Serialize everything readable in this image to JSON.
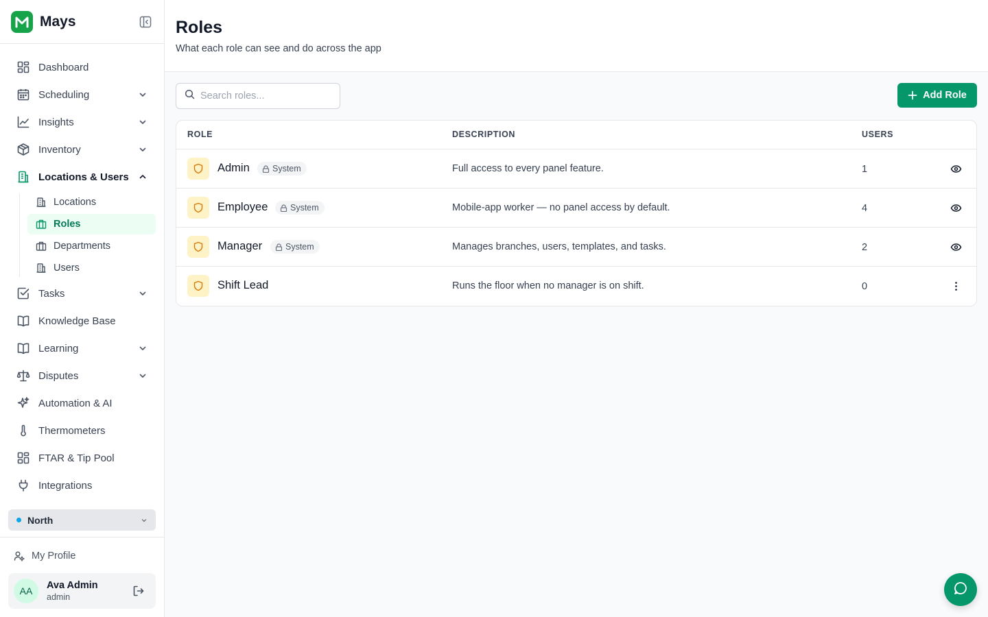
{
  "brand": {
    "name": "Mays",
    "accent": "#16a34a"
  },
  "sidebar": {
    "items": [
      {
        "label": "Dashboard",
        "icon": "dashboard-icon",
        "expandable": false
      },
      {
        "label": "Scheduling",
        "icon": "calendar-icon",
        "expandable": true
      },
      {
        "label": "Insights",
        "icon": "chart-line-icon",
        "expandable": true
      },
      {
        "label": "Inventory",
        "icon": "box-icon",
        "expandable": true
      },
      {
        "label": "Locations & Users",
        "icon": "building-icon",
        "expandable": true,
        "expanded": true
      }
    ],
    "sub_items": [
      {
        "label": "Locations",
        "icon": "building-icon"
      },
      {
        "label": "Roles",
        "icon": "briefcase-icon",
        "active": true
      },
      {
        "label": "Departments",
        "icon": "briefcase-icon"
      },
      {
        "label": "Users",
        "icon": "building-icon"
      }
    ],
    "items_after": [
      {
        "label": "Tasks",
        "icon": "checkbox-icon",
        "expandable": true
      },
      {
        "label": "Knowledge Base",
        "icon": "book-icon",
        "expandable": false
      },
      {
        "label": "Learning",
        "icon": "book-icon",
        "expandable": true
      },
      {
        "label": "Disputes",
        "icon": "scale-icon",
        "expandable": true
      },
      {
        "label": "Automation & AI",
        "icon": "sparkles-icon",
        "expandable": false
      },
      {
        "label": "Thermometers",
        "icon": "thermometer-icon",
        "expandable": false
      },
      {
        "label": "FTAR & Tip Pool",
        "icon": "dashboard-icon",
        "expandable": false
      },
      {
        "label": "Integrations",
        "icon": "plug-icon",
        "expandable": false
      }
    ],
    "branch": {
      "label": "North",
      "dot_color": "#0ea5e9"
    },
    "profile_link": "My Profile",
    "user": {
      "initials": "AA",
      "name": "Ava Admin",
      "role": "admin"
    }
  },
  "page": {
    "title": "Roles",
    "subtitle": "What each role can see and do across the app"
  },
  "search": {
    "placeholder": "Search roles..."
  },
  "add_button": {
    "label": "Add Role"
  },
  "table": {
    "headers": {
      "role": "ROLE",
      "description": "DESCRIPTION",
      "users": "USERS"
    },
    "rows": [
      {
        "name": "Admin",
        "system": true,
        "system_label": "System",
        "description": "Full access to every panel feature.",
        "users": "1",
        "action": "eye-icon"
      },
      {
        "name": "Employee",
        "system": true,
        "system_label": "System",
        "description": "Mobile-app worker — no panel access by default.",
        "users": "4",
        "action": "eye-icon"
      },
      {
        "name": "Manager",
        "system": true,
        "system_label": "System",
        "description": "Manages branches, users, templates, and tasks.",
        "users": "2",
        "action": "eye-icon"
      },
      {
        "name": "Shift Lead",
        "system": false,
        "system_label": "",
        "description": "Runs the floor when no manager is on shift.",
        "users": "0",
        "action": "more-vertical-icon"
      }
    ]
  },
  "colors": {
    "primary": "#059669",
    "role_icon_bg": "#fef3c7",
    "role_icon_stroke": "#d97706"
  }
}
